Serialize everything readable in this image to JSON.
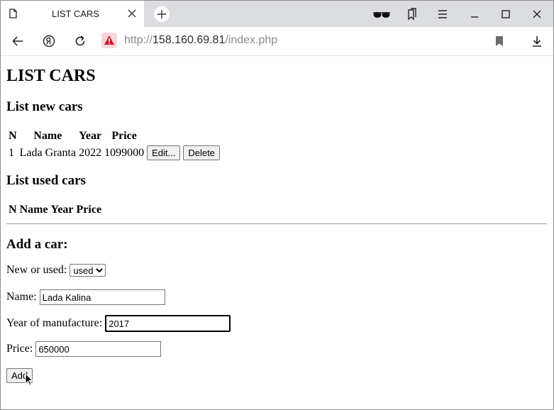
{
  "browser": {
    "tab_title": "LIST CARS",
    "url_scheme": "http://",
    "url_host": "158.160.69.81",
    "url_path": "/index.php"
  },
  "page": {
    "title": "LIST CARS",
    "new_cars": {
      "heading": "List new cars",
      "columns": [
        "N",
        "Name",
        "Year",
        "Price"
      ],
      "rows": [
        {
          "n": "1",
          "name": "Lada Granta",
          "year": "2022",
          "price": "1099000",
          "edit_label": "Edit...",
          "delete_label": "Delete"
        }
      ]
    },
    "used_cars": {
      "heading": "List used cars",
      "columns": [
        "N",
        "Name",
        "Year",
        "Price"
      ]
    },
    "form": {
      "heading": "Add a car:",
      "type_label": "New or used:",
      "type_value": "used",
      "name_label": "Name:",
      "name_value": "Lada Kalina",
      "year_label": "Year of manufacture:",
      "year_value": "2017",
      "price_label": "Price:",
      "price_value": "650000",
      "submit_label": "Add"
    }
  }
}
